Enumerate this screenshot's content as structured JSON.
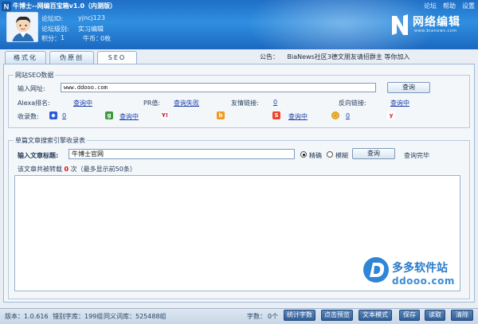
{
  "header": {
    "app_title": "牛博士--网编百宝箱v1.0（内测版）",
    "top_links": [
      "论坛",
      "帮助",
      "设置"
    ],
    "forum_id_label": "论坛ID:",
    "forum_id_value": "yjncj123",
    "forum_level_label": "论坛级别:",
    "forum_level_value": "实习编辑",
    "points_label": "积分：",
    "points_value": "1",
    "coins_label": "牛币：",
    "coins_value": "0枚",
    "logo_text": "网络编辑",
    "logo_sub": "www.bianews.com"
  },
  "tabs": [
    {
      "label": "格式化",
      "active": false
    },
    {
      "label": "伪原创",
      "active": false
    },
    {
      "label": "SEO",
      "active": true
    }
  ],
  "announcement": {
    "label": "公告：",
    "text": "BiaNews社区3德文朋友请招群主 等你加入"
  },
  "seo_group": {
    "legend": "网站SEO数据",
    "url_label": "输入网址:",
    "url_value": "www.ddooo.com",
    "query_button": "查询",
    "alexa_label": "Alexa排名:",
    "alexa_value": "查询中",
    "pr_label": "PR值:",
    "pr_value": "查询失败",
    "friend_links_label": "友情链接:",
    "friend_links_value": "0",
    "back_links_label": "反向链接:",
    "back_links_value": "查询中",
    "indexed_label": "收录数:",
    "indexed": [
      {
        "engine_icon": "baidu-icon",
        "color": "#2a5bd7",
        "value": "0"
      },
      {
        "engine_icon": "google-icon",
        "color": "#3a9a3a",
        "value": "查询中"
      },
      {
        "engine_icon": "yahoo-icon",
        "color": "#c8102e",
        "value": ""
      },
      {
        "engine_icon": "bing-icon",
        "color": "#f39a1c",
        "value": ""
      },
      {
        "engine_icon": "sogou-icon",
        "color": "#e8462b",
        "value": "查询中"
      },
      {
        "engine_icon": "360-icon",
        "color": "#e0a020",
        "value": "0"
      },
      {
        "engine_icon": "youdao-icon",
        "color": "#d3233a",
        "value": ""
      }
    ]
  },
  "article_group": {
    "legend": "单篇文章搜索引擎收录表",
    "title_label": "输入文章标题:",
    "title_value": "牛博士官网",
    "mode_exact": "精确",
    "mode_fuzzy": "模糊",
    "mode_selected": "精确",
    "query_button": "查询",
    "status": "查询完毕",
    "reprint_prefix": "该文章共被转载",
    "reprint_count": "0",
    "reprint_suffix": "次（最多显示前50条）"
  },
  "status_bar": {
    "version": "版本：1.0.616",
    "typo_db": "错别字库：199组",
    "synonym_db": "同义词库：525488组",
    "char_count_label": "字数：",
    "char_count_value": "0个",
    "buttons": [
      "统计字数",
      "点击预览",
      "文本模式",
      "保存",
      "读取",
      "清除"
    ]
  },
  "watermark": {
    "line1": "多多软件站",
    "line2": "ddooo.com"
  }
}
